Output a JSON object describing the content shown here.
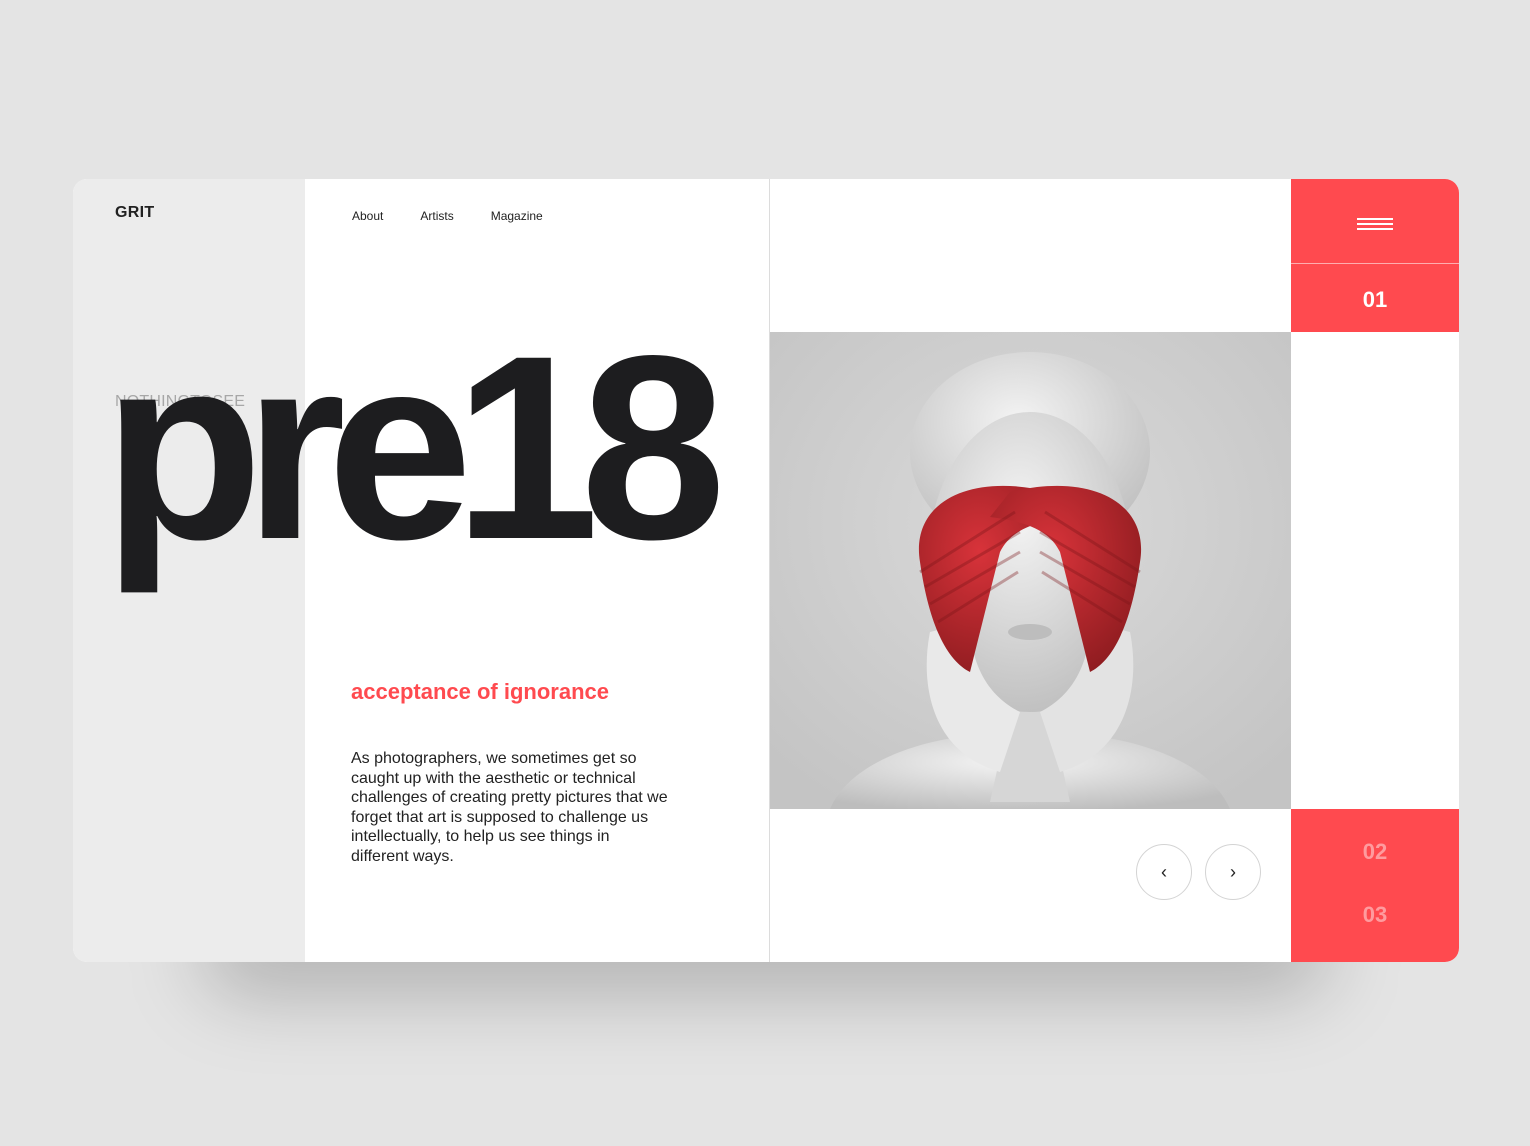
{
  "brand": {
    "logo": "GRIT"
  },
  "nav": {
    "items": [
      "About",
      "Artists",
      "Magazine"
    ]
  },
  "hero": {
    "kicker": "NOTHINGTOSEE",
    "title": "pre18",
    "tagline": "acceptance of ignorance",
    "body": "As photographers, we sometimes get so caught up with the aesthetic or technical challenges of creating pretty pictures that we forget that art is supposed to challenge us intellectually, to help us see things in different ways."
  },
  "slider": {
    "current": "01",
    "others": [
      "02",
      "03"
    ],
    "prev_icon": "chevron-left-icon",
    "next_icon": "chevron-right-icon",
    "prev_glyph": "‹",
    "next_glyph": "›"
  },
  "colors": {
    "accent": "#ff4a4f",
    "background": "#e4e4e4",
    "panel": "#ececec",
    "text": "#1d1d1f"
  }
}
